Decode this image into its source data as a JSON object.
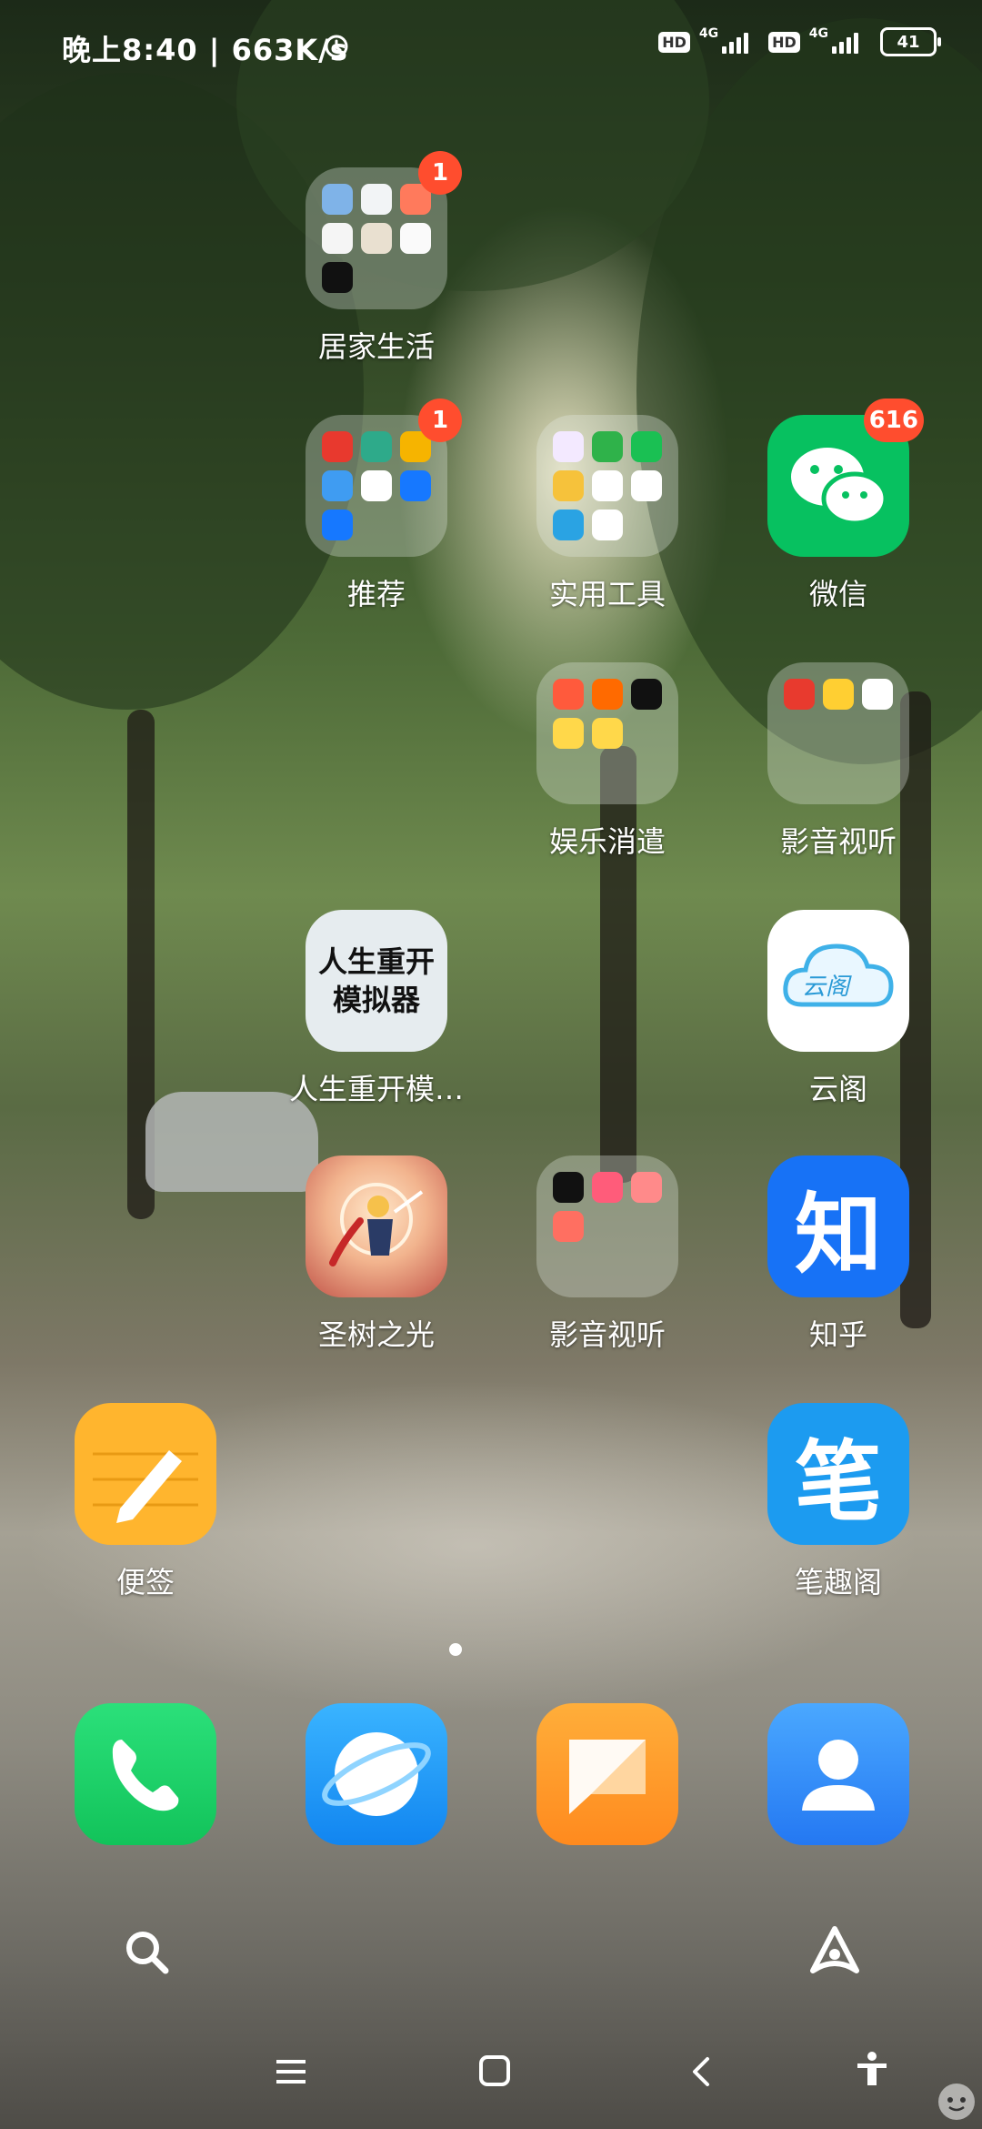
{
  "status_bar": {
    "time_speed": "晚上8:40 | 663K/s",
    "hd_label": "HD",
    "network_label": "4G",
    "battery_level": "41",
    "alarm_icon": "alarm-clock-icon"
  },
  "home_screen": {
    "folders": {
      "home_life": {
        "label": "居家生活",
        "badge": "1"
      },
      "recommended": {
        "label": "推荐",
        "badge": "1"
      },
      "utilities": {
        "label": "实用工具"
      },
      "entertainment": {
        "label": "娱乐消遣"
      },
      "media_top": {
        "label": "影音视听"
      },
      "media_bottom": {
        "label": "影音视听"
      }
    },
    "apps": {
      "wechat": {
        "label": "微信",
        "badge": "616",
        "color": "#07c160"
      },
      "life_restart": {
        "label": "人生重开模…",
        "icon_text": "人生重开模拟器"
      },
      "yunge": {
        "label": "云阁",
        "icon_text": "云阁"
      },
      "holy_tree": {
        "label": "圣树之光"
      },
      "zhihu": {
        "label": "知乎",
        "icon_text": "知",
        "color": "#1772f6"
      },
      "notes": {
        "label": "便签",
        "color": "#ffb52e"
      },
      "biquge": {
        "label": "笔趣阁",
        "icon_text": "笔",
        "color": "#1c9bf0"
      }
    }
  },
  "page_indicator": {
    "current": 1,
    "total": 1
  },
  "dock": {
    "phone": "phone-icon",
    "browser": "browser-icon",
    "messages": "messages-icon",
    "contacts": "contacts-icon"
  },
  "quick_bar": {
    "search": "search-icon",
    "assistant": "assistant-icon"
  },
  "nav_bar": {
    "menu": "menu-icon",
    "home": "home-icon",
    "back": "back-icon",
    "accessibility": "accessibility-icon"
  }
}
